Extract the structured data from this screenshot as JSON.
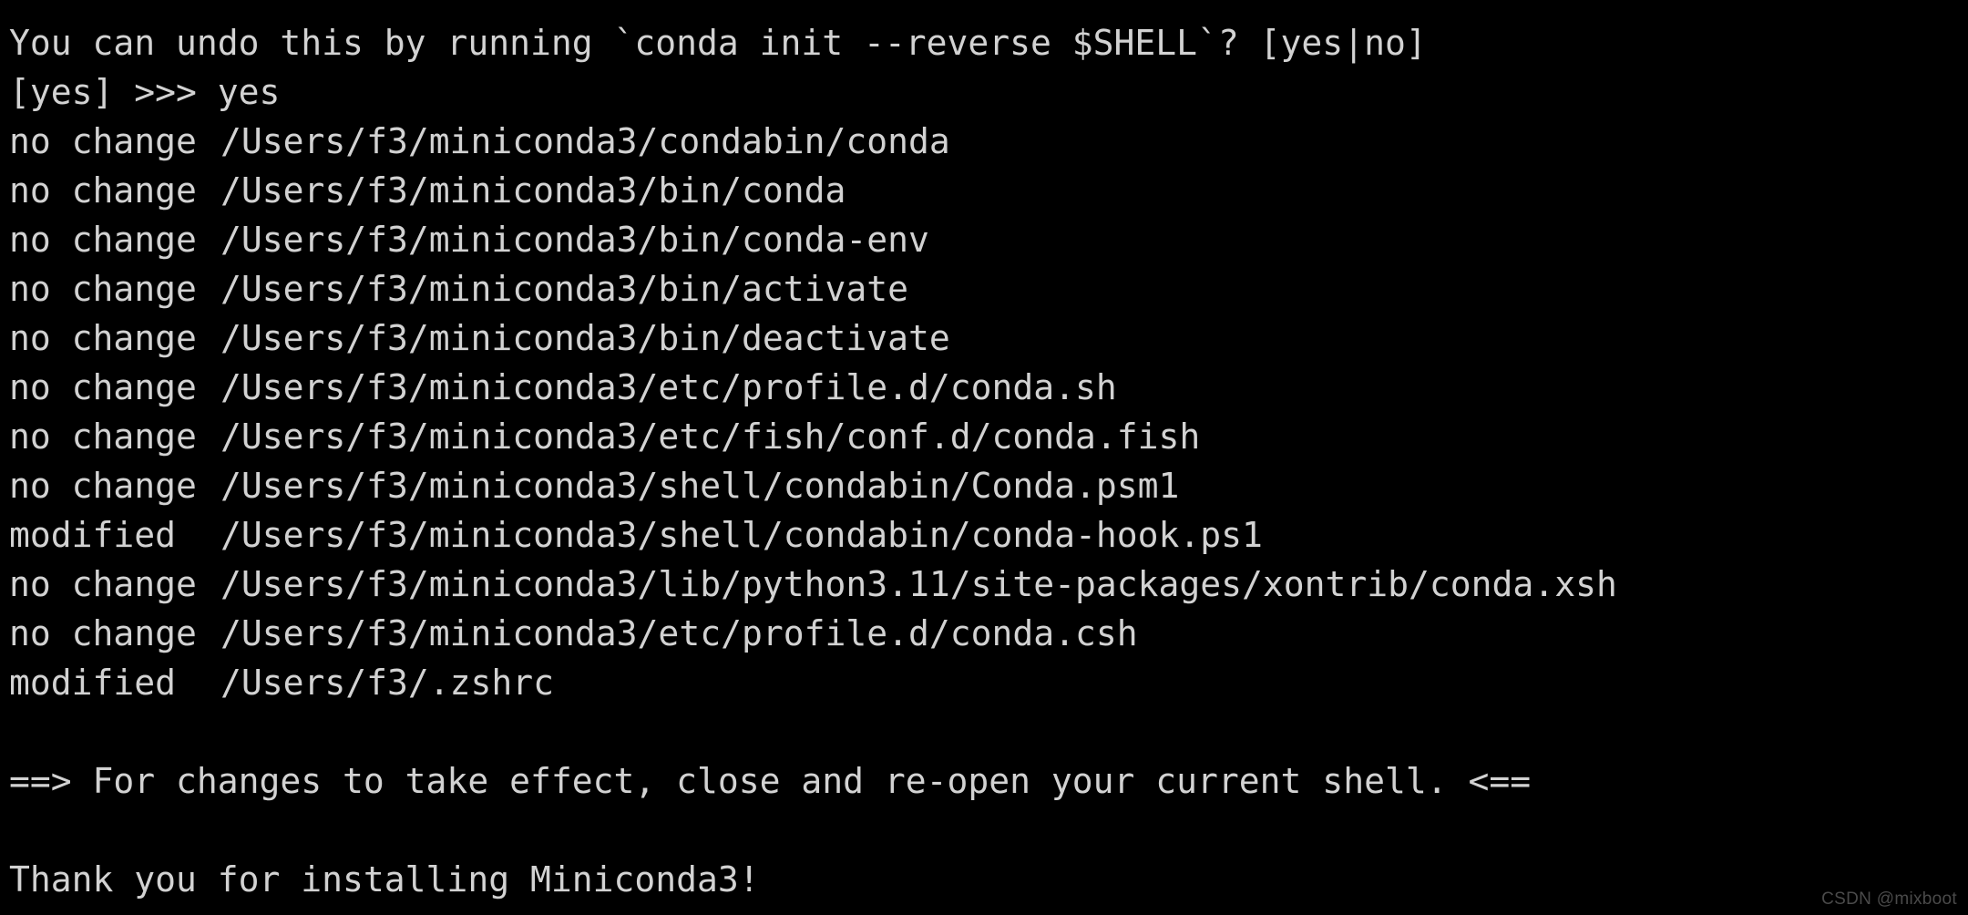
{
  "terminal": {
    "background_color": "#000000",
    "foreground_color": "#d2d2d2",
    "prompt_line": "You can undo this by running `conda init --reverse $SHELL`? [yes|no]",
    "answer_line": "[yes] >>> yes",
    "entries": [
      {
        "status": "no change",
        "path": "/Users/f3/miniconda3/condabin/conda"
      },
      {
        "status": "no change",
        "path": "/Users/f3/miniconda3/bin/conda"
      },
      {
        "status": "no change",
        "path": "/Users/f3/miniconda3/bin/conda-env"
      },
      {
        "status": "no change",
        "path": "/Users/f3/miniconda3/bin/activate"
      },
      {
        "status": "no change",
        "path": "/Users/f3/miniconda3/bin/deactivate"
      },
      {
        "status": "no change",
        "path": "/Users/f3/miniconda3/etc/profile.d/conda.sh"
      },
      {
        "status": "no change",
        "path": "/Users/f3/miniconda3/etc/fish/conf.d/conda.fish"
      },
      {
        "status": "no change",
        "path": "/Users/f3/miniconda3/shell/condabin/Conda.psm1"
      },
      {
        "status": "modified",
        "path": "/Users/f3/miniconda3/shell/condabin/conda-hook.ps1"
      },
      {
        "status": "no change",
        "path": "/Users/f3/miniconda3/lib/python3.11/site-packages/xontrib/conda.xsh"
      },
      {
        "status": "no change",
        "path": "/Users/f3/miniconda3/etc/profile.d/conda.csh"
      },
      {
        "status": "modified",
        "path": "/Users/f3/.zshrc"
      }
    ],
    "effect_notice": "==> For changes to take effect, close and re-open your current shell. <==",
    "thank_you": "Thank you for installing Miniconda3!"
  },
  "watermark": {
    "text": "CSDN @mixboot",
    "color": "#4a4a4a"
  }
}
